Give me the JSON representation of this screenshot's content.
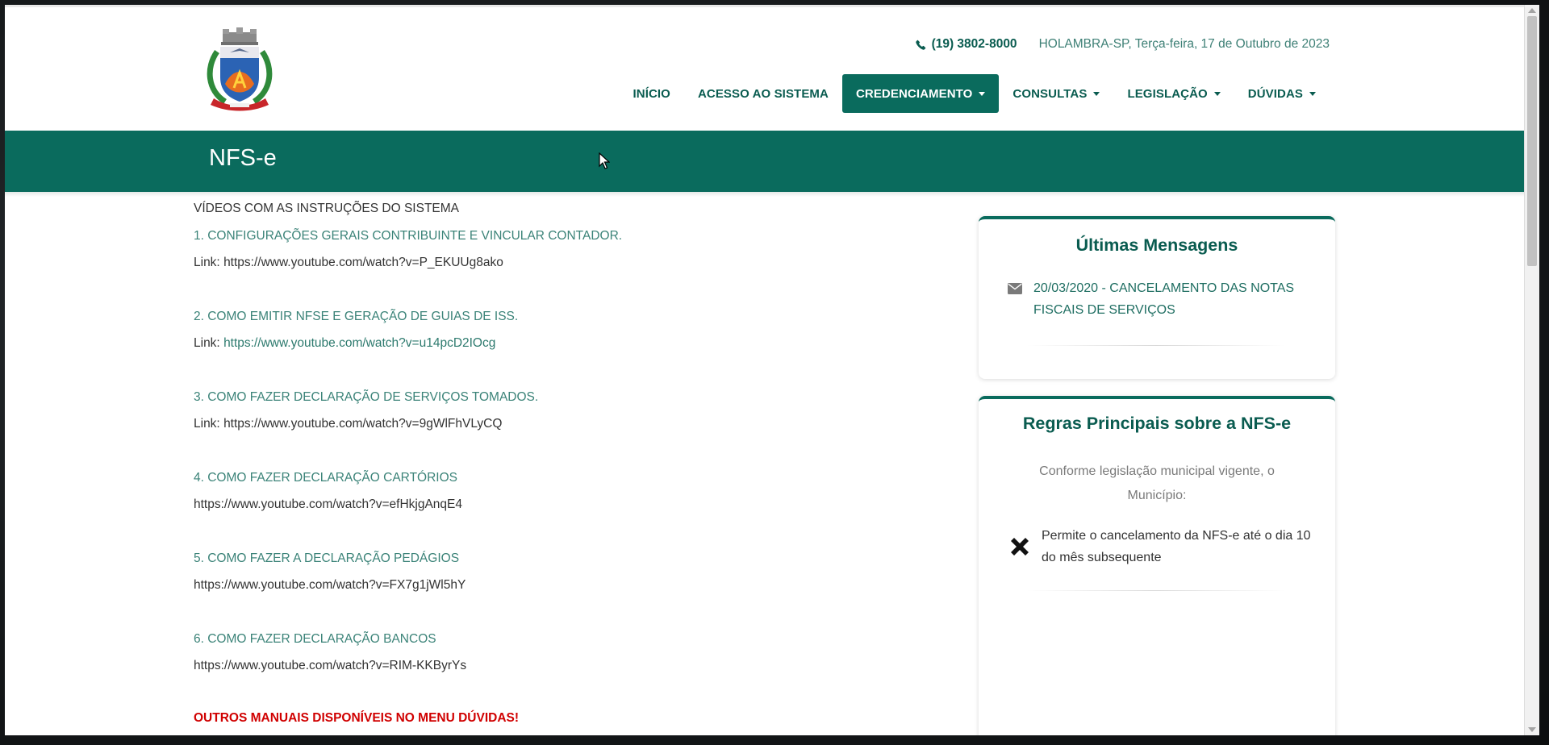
{
  "header": {
    "phone": "(19) 3802-8000",
    "location_date": "HOLAMBRA-SP, Terça-feira, 17 de Outubro de 2023",
    "nav": [
      {
        "label": "INÍCIO",
        "dropdown": false,
        "active": false
      },
      {
        "label": "ACESSO AO SISTEMA",
        "dropdown": false,
        "active": false
      },
      {
        "label": "CREDENCIAMENTO",
        "dropdown": true,
        "active": true
      },
      {
        "label": "CONSULTAS",
        "dropdown": true,
        "active": false
      },
      {
        "label": "LEGISLAÇÃO",
        "dropdown": true,
        "active": false
      },
      {
        "label": "DÚVIDAS",
        "dropdown": true,
        "active": false
      }
    ]
  },
  "page": {
    "title": "NFS-e"
  },
  "main": {
    "heading": "VÍDEOS COM AS INSTRUÇÕES DO SISTEMA",
    "videos": [
      {
        "title": "1. CONFIGURAÇÕES GERAIS CONTRIBUINTE E VINCULAR CONTADOR.",
        "prefix": "Link: ",
        "url": "https://www.youtube.com/watch?v=P_EKUUg8ako"
      },
      {
        "title": "2. COMO EMITIR NFSE E GERAÇÃO DE GUIAS DE ISS.",
        "prefix": "Link: ",
        "url": "https://www.youtube.com/watch?v=u14pcD2IOcg"
      },
      {
        "title": "3. COMO FAZER DECLARAÇÃO DE SERVIÇOS TOMADOS.",
        "prefix": "Link: ",
        "url": "https://www.youtube.com/watch?v=9gWlFhVLyCQ"
      },
      {
        "title": "4. COMO FAZER DECLARAÇÃO CARTÓRIOS",
        "prefix": "",
        "url": "https://www.youtube.com/watch?v=efHkjgAnqE4"
      },
      {
        "title": "5. COMO FAZER A DECLARAÇÃO PEDÁGIOS",
        "prefix": "",
        "url": "https://www.youtube.com/watch?v=FX7g1jWl5hY"
      },
      {
        "title": "6. COMO FAZER DECLARAÇÃO BANCOS",
        "prefix": "",
        "url": "https://www.youtube.com/watch?v=RIM-KKByrYs"
      }
    ],
    "other_manuals": "OUTROS MANUAIS DISPONÍVEIS NO MENU DÚVIDAS!"
  },
  "sidebar": {
    "messages_title": "Últimas Mensagens",
    "message": "20/03/2020 - CANCELAMENTO DAS NOTAS FISCAIS DE SERVIÇOS",
    "rules_title": "Regras Principais sobre a NFS-e",
    "rules_intro": "Conforme legislação municipal vigente, o Município:",
    "rule": "Permite o cancelamento da NFS-e até o dia 10 do mês subsequente"
  },
  "colors": {
    "brand": "#0a6b5d",
    "link_teal": "#3b8378",
    "alert_red": "#d00000"
  }
}
